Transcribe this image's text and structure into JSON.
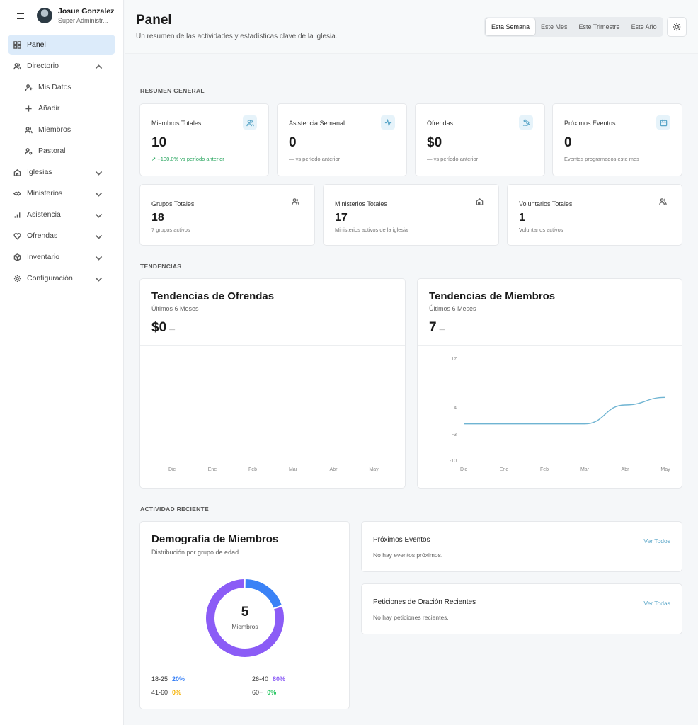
{
  "user": {
    "name": "Josue Gonzalez",
    "role": "Super Administr..."
  },
  "nav": {
    "panel": "Panel",
    "directorio": "Directorio",
    "mis_datos": "Mis Datos",
    "anadir": "Añadir",
    "miembros": "Miembros",
    "pastoral": "Pastoral",
    "iglesias": "Iglesias",
    "ministerios": "Ministerios",
    "asistencia": "Asistencia",
    "ofrendas": "Ofrendas",
    "inventario": "Inventario",
    "configuracion": "Configuración"
  },
  "header": {
    "title": "Panel",
    "subtitle": "Un resumen de las actividades y estadísticas clave de la iglesia."
  },
  "periods": [
    "Esta Semana",
    "Este Mes",
    "Este Trimestre",
    "Este Año"
  ],
  "selected_period": "Esta Semana",
  "sections": {
    "overview": "RESUMEN GENERAL",
    "trends": "TENDENCIAS",
    "activity": "ACTIVIDAD RECIENTE"
  },
  "stats": [
    {
      "title": "Miembros Totales",
      "value": "10",
      "note": "+100.0% vs período anterior"
    },
    {
      "title": "Asistencia Semanal",
      "value": "0",
      "note": "— vs período anterior"
    },
    {
      "title": "Ofrendas",
      "value": "$0",
      "note": "— vs período anterior"
    },
    {
      "title": "Próximos Eventos",
      "value": "0",
      "note": "Eventos programados este mes"
    }
  ],
  "stats2": [
    {
      "title": "Grupos Totales",
      "value": "18",
      "note": "7 grupos activos"
    },
    {
      "title": "Ministerios Totales",
      "value": "17",
      "note": "Ministerios activos de la iglesia"
    },
    {
      "title": "Voluntarios Totales",
      "value": "1",
      "note": "Voluntarios activos"
    }
  ],
  "offerings_chart": {
    "title": "Tendencias de Ofrendas",
    "subtitle": "Últimos 6 Meses",
    "value": "$0",
    "delta": "—"
  },
  "members_chart": {
    "title": "Tendencias de Miembros",
    "subtitle": "Últimos 6 Meses",
    "value": "7",
    "delta": "—"
  },
  "chart_data": [
    {
      "type": "line",
      "title": "Tendencias de Ofrendas",
      "x": [
        "Dic",
        "Ene",
        "Feb",
        "Mar",
        "Abr",
        "May"
      ],
      "series": [
        {
          "values": [
            0,
            0,
            0,
            0,
            0,
            0
          ]
        }
      ],
      "ylim": [
        0,
        0
      ],
      "grid": false
    },
    {
      "type": "line",
      "title": "Tendencias de Miembros",
      "x": [
        "Dic",
        "Ene",
        "Feb",
        "Mar",
        "Abr",
        "May"
      ],
      "yticks": [
        17,
        4,
        -3,
        -10
      ],
      "ylim": [
        -10,
        17
      ],
      "series": [
        {
          "values": [
            0,
            0,
            0,
            0,
            5,
            7
          ],
          "color": "#6fb4d2"
        }
      ],
      "grid": false
    },
    {
      "type": "pie",
      "title": "Demografía de Miembros",
      "subtitle": "Distribución por grupo de edad",
      "center_value": "5",
      "center_label": "Miembros",
      "slices": [
        {
          "label": "18-25",
          "value": 20,
          "color": "#3b82f6"
        },
        {
          "label": "26-40",
          "value": 80,
          "color": "#8b5cf6"
        },
        {
          "label": "41-60",
          "value": 0,
          "color": "#f5b100"
        },
        {
          "label": "60+",
          "value": 0,
          "color": "#22c55e"
        }
      ]
    }
  ],
  "demographics": {
    "title": "Demografía de Miembros",
    "subtitle": "Distribución por grupo de edad",
    "center_value": "5",
    "center_label": "Miembros",
    "legend": [
      {
        "label": "18-25",
        "pct": "20%"
      },
      {
        "label": "26-40",
        "pct": "80%"
      },
      {
        "label": "41-60",
        "pct": "0%"
      },
      {
        "label": "60+",
        "pct": "0%"
      }
    ]
  },
  "events": {
    "title": "Próximos Eventos",
    "empty": "No hay eventos próximos.",
    "link": "Ver Todos"
  },
  "prayers": {
    "title": "Peticiones de Oración Recientes",
    "empty": "No hay peticiones recientes.",
    "link": "Ver Todas"
  }
}
